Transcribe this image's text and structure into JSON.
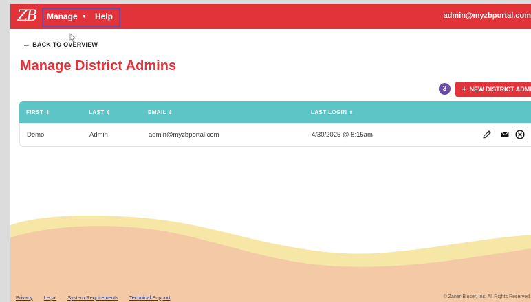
{
  "header": {
    "logo_text": "ZB",
    "nav": [
      {
        "label": "Manage",
        "caret": "▼"
      },
      {
        "label": "Help"
      }
    ],
    "user_email": "admin@myzbportal.com"
  },
  "back_link": {
    "arrow": "←",
    "label": "BACK TO OVERVIEW"
  },
  "page_title": "Manage District Admins",
  "step_badge": "3",
  "new_button": {
    "icon": "+",
    "label": "NEW DISTRICT ADMIN"
  },
  "table": {
    "columns": [
      "FIRST ⇕",
      "LAST ⇕",
      "EMAIL ⇕",
      "LAST LOGIN ⇕"
    ],
    "rows": [
      {
        "first": "Demo",
        "last": "Admin",
        "email": "admin@myzbportal.com",
        "last_login": "4/30/2025 @ 8:15am"
      }
    ],
    "row_actions": [
      "pencil-icon",
      "envelope-icon",
      "remove-circle-icon"
    ]
  },
  "footer": {
    "links": [
      "Privacy",
      "Legal",
      "System Requirements",
      "Technical Support"
    ],
    "copyright": "© Zaner-Bloser, Inc. All Rights Reserved."
  },
  "colors": {
    "brand_red": "#e2333b",
    "table_header_teal": "#5ec5c7",
    "badge_purple": "#6c4ba6",
    "wave_yellow": "#f6e7a6",
    "wave_peach": "#f4caa6"
  }
}
